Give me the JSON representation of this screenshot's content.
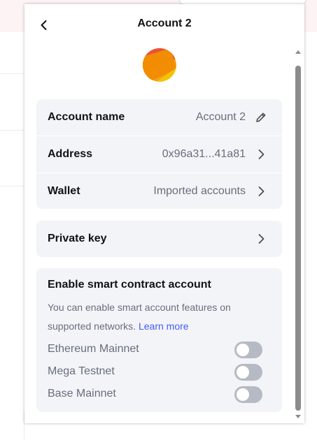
{
  "header": {
    "title": "Account 2",
    "back_icon": "arrow-left-icon"
  },
  "avatar": {
    "colors": [
      "#f28c00",
      "#e8533a",
      "#f5a31a"
    ]
  },
  "details": {
    "account_name": {
      "label": "Account name",
      "value": "Account 2",
      "icon": "pencil-edit-icon"
    },
    "address": {
      "label": "Address",
      "value": "0x96a31...41a81",
      "icon": "chevron-right-icon"
    },
    "wallet": {
      "label": "Wallet",
      "value": "Imported accounts",
      "icon": "chevron-right-icon"
    }
  },
  "private_key": {
    "label": "Private key",
    "icon": "chevron-right-icon"
  },
  "smart_account": {
    "title": "Enable smart contract account",
    "description": "You can enable smart account features on supported networks.",
    "learn_more": "Learn more",
    "networks": [
      {
        "name": "Ethereum Mainnet",
        "enabled": false
      },
      {
        "name": "Mega Testnet",
        "enabled": false
      },
      {
        "name": "Base Mainnet",
        "enabled": false
      }
    ]
  },
  "colors": {
    "card_bg": "#f3f4f7",
    "muted_text": "#686e7d",
    "link": "#4459ff",
    "toggle_off": "#b6bac4"
  }
}
